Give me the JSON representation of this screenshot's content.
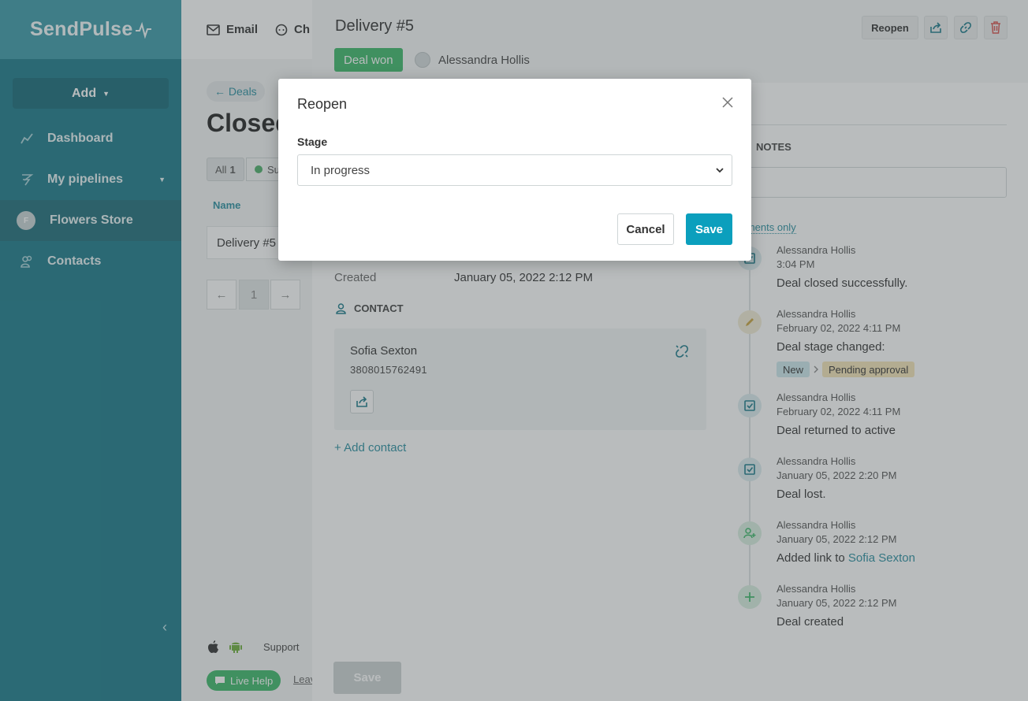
{
  "brand": {
    "name": "SendPulse"
  },
  "sidebar": {
    "add_label": "Add",
    "items": [
      {
        "label": "Dashboard",
        "icon": "chart-line-icon"
      },
      {
        "label": "My pipelines",
        "icon": "funnel-icon"
      },
      {
        "label": "Flowers Store",
        "icon": "avatar-icon",
        "avatar_letter": "F"
      },
      {
        "label": "Contacts",
        "icon": "contacts-icon"
      }
    ],
    "support_label": "Support",
    "live_help_label": "Live Help",
    "leave_label": "Leav"
  },
  "topbar": {
    "email_label": "Email",
    "chat_label": "Ch"
  },
  "background": {
    "back_label": "← Deals",
    "page_title": "Closed",
    "filter_all_label": "All",
    "filter_all_count": "1",
    "filter_s_label": "Su",
    "column_name": "Name",
    "row_deal": "Delivery #5",
    "pager_prev": "←",
    "pager_current": "1",
    "pager_next": "→"
  },
  "deal": {
    "title": "Delivery #5",
    "status_badge": "Deal won",
    "owner": "Alessandra Hollis",
    "reopen_label": "Reopen",
    "created_label": "Created",
    "created_value": "January 05, 2022 2:12 PM",
    "contact_section": "CONTACT",
    "contact": {
      "name": "Sofia Sexton",
      "phone": "3808015762491"
    },
    "add_contact_label": "+ Add contact",
    "save_label": "Save"
  },
  "notes": {
    "header": "NOTES",
    "comments_only_label": "mments only"
  },
  "timeline": [
    {
      "author": "Alessandra Hollis",
      "time": "3:04 PM",
      "text": "Deal closed successfully.",
      "icon": "check-square-icon"
    },
    {
      "author": "Alessandra Hollis",
      "time": "February 02, 2022 4:11 PM",
      "text": "Deal stage changed:",
      "icon": "pencil-icon",
      "from_stage": "New",
      "to_stage": "Pending approval"
    },
    {
      "author": "Alessandra Hollis",
      "time": "February 02, 2022 4:11 PM",
      "text": "Deal returned to active",
      "icon": "check-square-icon"
    },
    {
      "author": "Alessandra Hollis",
      "time": "January 05, 2022 2:20 PM",
      "text": "Deal lost.",
      "icon": "check-square-icon"
    },
    {
      "author": "Alessandra Hollis",
      "time": "January 05, 2022 2:12 PM",
      "text": "Added link to ",
      "link": "Sofia Sexton",
      "icon": "user-plus-icon"
    },
    {
      "author": "Alessandra Hollis",
      "time": "January 05, 2022 2:12 PM",
      "text": "Deal created",
      "icon": "plus-icon"
    }
  ],
  "modal": {
    "title": "Reopen",
    "stage_label": "Stage",
    "stage_value": "In progress",
    "cancel_label": "Cancel",
    "save_label": "Save"
  },
  "colors": {
    "sidebar": "#1a7a8a",
    "accent": "#0b9fbd",
    "won": "#3cb86a",
    "delete": "#d9534f"
  }
}
